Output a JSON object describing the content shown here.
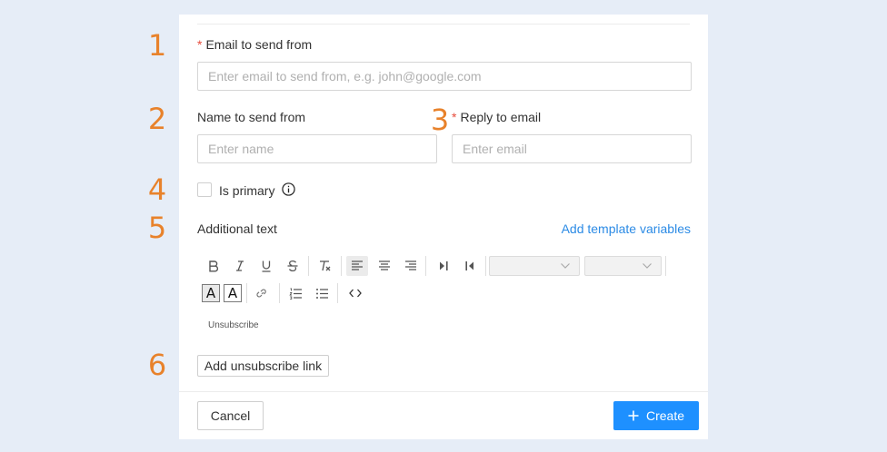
{
  "step_numbers": [
    "1",
    "2",
    "3",
    "4",
    "5",
    "6"
  ],
  "form": {
    "email_from": {
      "required_mark": "*",
      "label": "Email to send from",
      "placeholder": "Enter email to send from, e.g. john@google.com"
    },
    "name_from": {
      "label": "Name to send from",
      "placeholder": "Enter name"
    },
    "reply_to": {
      "required_mark": "*",
      "label": "Reply to email",
      "placeholder": "Enter email"
    },
    "is_primary": {
      "label": "Is primary",
      "checked": false,
      "info_icon": "info-icon"
    },
    "additional_text": {
      "label": "Additional text",
      "add_variables_link": "Add template variables",
      "editor_content": "Unsubscribe",
      "font_color_glyph": "A",
      "bg_color_glyph": "A"
    },
    "add_unsubscribe_button": "Add unsubscribe link"
  },
  "footer": {
    "cancel_label": "Cancel",
    "create_label": "Create",
    "create_icon": "plus-icon"
  },
  "colors": {
    "accent": "#1e90ff",
    "link": "#2c8be5",
    "required": "#e74c3c",
    "step_number": "#e8822b"
  }
}
